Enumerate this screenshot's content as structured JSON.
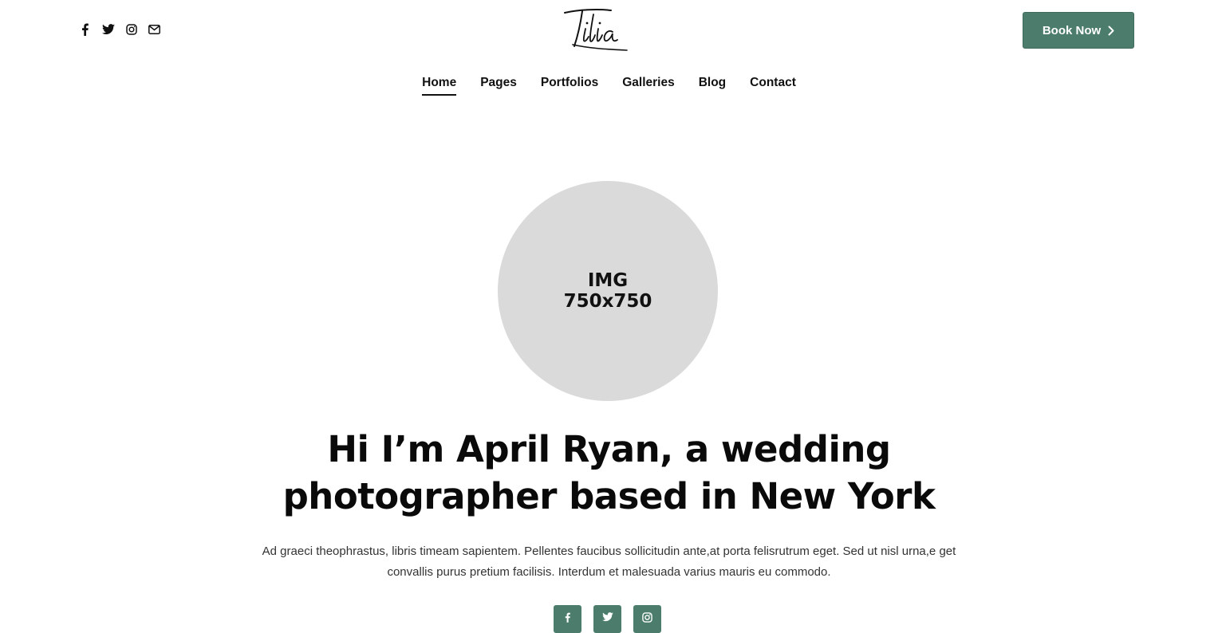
{
  "header": {
    "social_icons": [
      "facebook-icon",
      "twitter-icon",
      "instagram-icon",
      "envelope-icon"
    ],
    "logo_text": "Tilia",
    "book_button": {
      "label": "Book Now",
      "icon": "chevron-right-icon"
    },
    "nav": [
      {
        "label": "Home",
        "active": true
      },
      {
        "label": "Pages",
        "active": false
      },
      {
        "label": "Portfolios",
        "active": false
      },
      {
        "label": "Galleries",
        "active": false
      },
      {
        "label": "Blog",
        "active": false
      },
      {
        "label": "Contact",
        "active": false
      }
    ]
  },
  "hero": {
    "image_placeholder": {
      "line1": "IMG",
      "line2": "750x750"
    },
    "title_line1": "Hi I’m April Ryan, a wedding",
    "title_line2": "photographer based in New York",
    "description_line1": "Ad graeci theophrastus, libris timeam sapientem. Pellentes faucibus sollicitudin ante,at porta felisrutrum eget. Sed ut nisl urna,e get",
    "description_line2": "convallis purus pretium facilisis. Interdum et malesuada varius mauris eu commodo.",
    "social_icons": [
      "facebook-icon",
      "twitter-icon",
      "instagram-icon"
    ]
  },
  "colors": {
    "accent": "#4b7c6c",
    "placeholder": "#dadada",
    "text": "#111111"
  }
}
